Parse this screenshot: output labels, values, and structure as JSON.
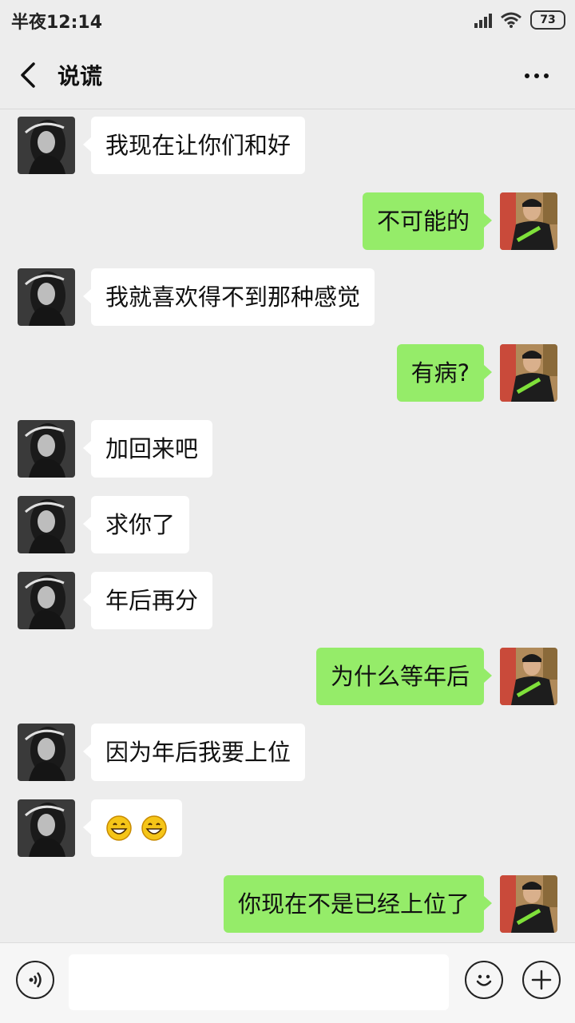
{
  "status_bar": {
    "time": "半夜12:14",
    "battery": "73"
  },
  "header": {
    "title": "说谎"
  },
  "messages": [
    {
      "side": "left",
      "text": "我现在让你们和好"
    },
    {
      "side": "right",
      "text": "不可能的"
    },
    {
      "side": "left",
      "text": "我就喜欢得不到那种感觉"
    },
    {
      "side": "right",
      "text": "有病?"
    },
    {
      "side": "left",
      "text": "加回来吧"
    },
    {
      "side": "left",
      "text": "求你了"
    },
    {
      "side": "left",
      "text": "年后再分"
    },
    {
      "side": "right",
      "text": "为什么等年后"
    },
    {
      "side": "left",
      "text": "因为年后我要上位"
    },
    {
      "side": "left",
      "emoji": [
        "grinning-face",
        "grinning-face"
      ]
    },
    {
      "side": "right",
      "text": "你现在不是已经上位了"
    }
  ],
  "input": {
    "value": ""
  },
  "colors": {
    "background": "#ededed",
    "sent_bubble": "#95ec69",
    "received_bubble": "#ffffff"
  }
}
